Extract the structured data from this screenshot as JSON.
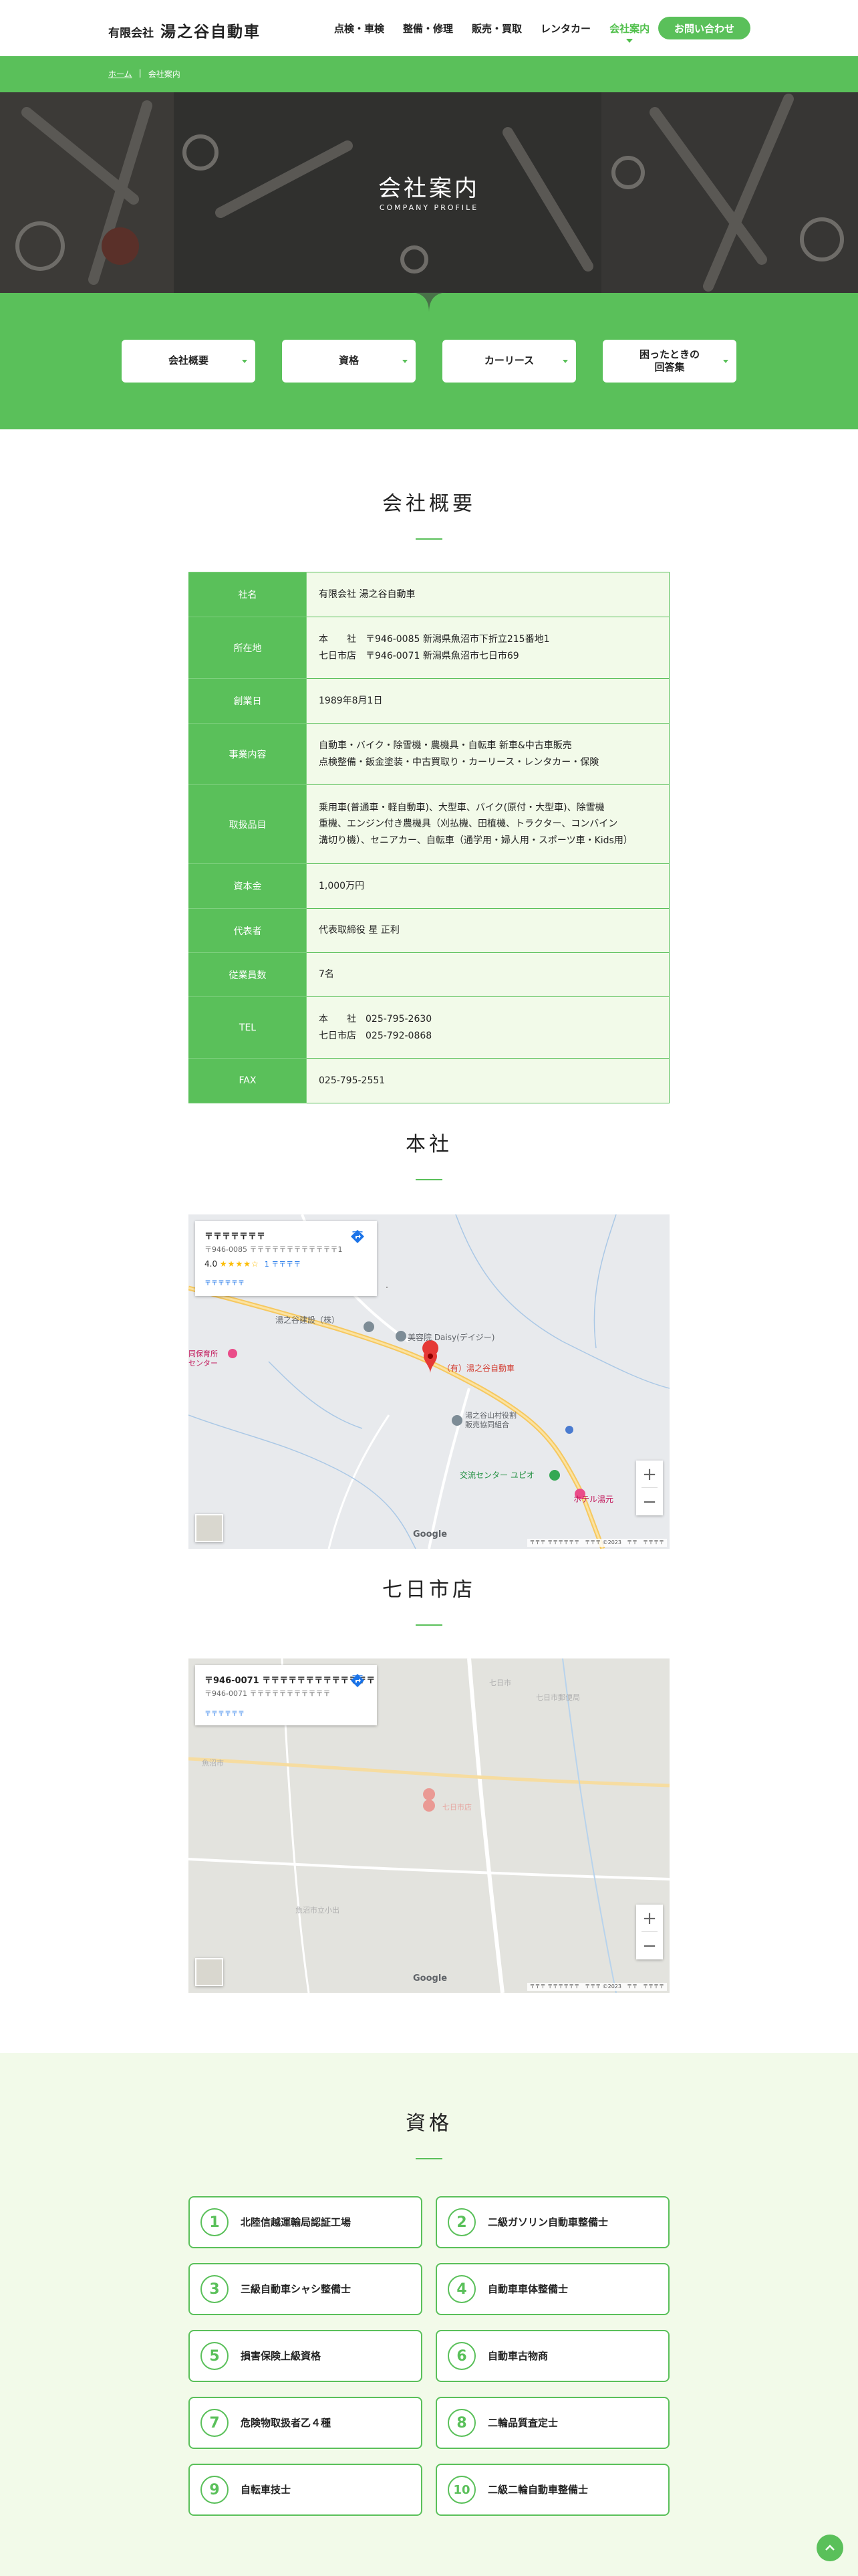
{
  "header": {
    "logo_small": "有限会社",
    "logo_big": "湯之谷自動車",
    "nav": [
      "点検・車検",
      "整備・修理",
      "販売・買取",
      "レンタカー",
      "会社案内"
    ],
    "contact": "お問い合わせ"
  },
  "breadcrumb": {
    "home": "ホーム",
    "sep": "|",
    "current": "会社案内"
  },
  "hero": {
    "title": "会社案内",
    "subtitle": "COMPANY PROFILE"
  },
  "tabs": [
    "会社概要",
    "資格",
    "カーリース",
    "困ったときの\n回答集"
  ],
  "overview": {
    "title": "会社概要",
    "rows": [
      {
        "label": "社名",
        "value": "有限会社 湯之谷自動車"
      },
      {
        "label": "所在地",
        "value": "本　　社　〒946-0085 新潟県魚沼市下折立215番地1\n七日市店　〒946-0071 新潟県魚沼市七日市69"
      },
      {
        "label": "創業日",
        "value": "1989年8月1日"
      },
      {
        "label": "事業内容",
        "value": "自動車・バイク・除雪機・農機具・自転車 新車&中古車販売\n点検整備・鈑金塗装・中古買取り・カーリース・レンタカー・保険"
      },
      {
        "label": "取扱品目",
        "value": "乗用車(普通車・軽自動車)、大型車、バイク(原付・大型車)、除雪機\n重機、エンジン付き農機具（刈払機、田植機、トラクター、コンバイン\n溝切り機）、セニアカー、自転車（通学用・婦人用・スポーツ車・Kids用）"
      },
      {
        "label": "資本金",
        "value": "1,000万円"
      },
      {
        "label": "代表者",
        "value": "代表取締役 星 正利"
      },
      {
        "label": "従業員数",
        "value": "7名"
      },
      {
        "label": "TEL",
        "value": "本　　社　025-795-2630\n七日市店　025-792-0868"
      },
      {
        "label": "FAX",
        "value": "025-795-2551"
      }
    ]
  },
  "maps": [
    {
      "title": "本社",
      "card_title": "〒〒〒〒〒〒〒",
      "card_addr": "〒946-0085 〒〒〒〒〒〒〒〒〒〒〒〒1",
      "rating": "4.0",
      "stars": "★★★★☆",
      "reviews": "1 〒〒〒〒",
      "more": "〒〒〒〒〒〒",
      "dir": "〒〒",
      "labels": [
        "湯之谷建設（株）",
        "美容院 Daisy(デイジー)",
        "（有）湯之谷自動車",
        "湯之谷山村役割\n販売協同組合",
        "交流センター ユピオ",
        "ホテル湯元",
        "〒〒保育所\nセンター"
      ],
      "google": "Google",
      "foot": "〒〒〒 〒〒〒〒〒〒　〒〒〒 ©2023　〒〒　〒〒〒〒"
    },
    {
      "title": "七日市店",
      "card_title": "〒946-0071 〒〒〒〒〒〒〒〒〒〒〒〒〒",
      "card_addr": "〒946-0071 〒〒〒〒〒〒〒〒〒〒〒",
      "more": "〒〒〒〒〒〒",
      "dir": "〒〒",
      "google": "Google",
      "foot": "〒〒〒 〒〒〒〒〒〒　〒〒〒 ©2023　〒〒　〒〒〒〒"
    }
  ],
  "quals": {
    "title": "資格",
    "items": [
      {
        "num": "1",
        "label": "北陸信越運輸局認証工場"
      },
      {
        "num": "2",
        "label": "二級ガソリン自動車整備士"
      },
      {
        "num": "3",
        "label": "三級自動車シャシ整備士"
      },
      {
        "num": "4",
        "label": "自動車車体整備士"
      },
      {
        "num": "5",
        "label": "損害保険上級資格"
      },
      {
        "num": "6",
        "label": "自動車古物商"
      },
      {
        "num": "7",
        "label": "危険物取扱者乙４種"
      },
      {
        "num": "8",
        "label": "二輪品質査定士"
      },
      {
        "num": "9",
        "label": "自転車技士"
      },
      {
        "num": "10",
        "label": "二級二輪自動車整備士"
      }
    ]
  },
  "colors": {
    "brand_green": "#5ac05a",
    "light_green": "#f2fae9"
  }
}
